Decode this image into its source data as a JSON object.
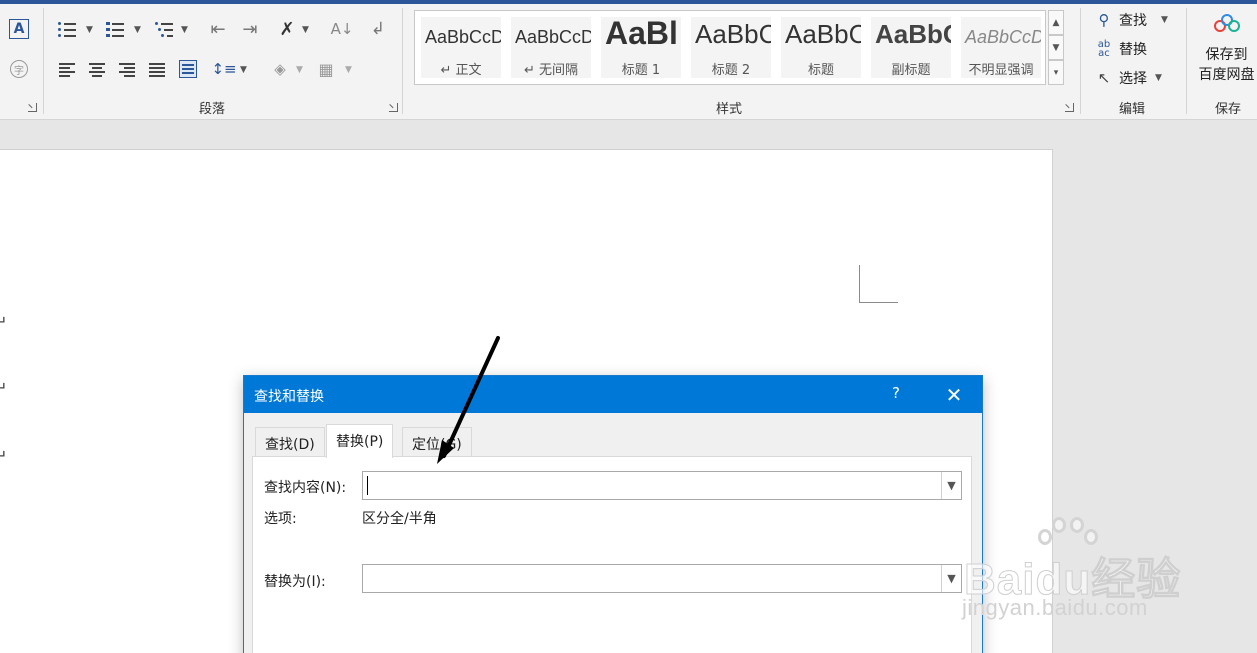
{
  "ribbon": {
    "paragraph_group_label": "段落",
    "styles_group_label": "样式",
    "editing_group_label": "编辑",
    "save_group_label": "保存",
    "styles": [
      {
        "sample": "AaBbCcDd",
        "name": "↵ 正文"
      },
      {
        "sample": "AaBbCcDd",
        "name": "↵ 无间隔"
      },
      {
        "sample": "AaBl",
        "name": "标题 1"
      },
      {
        "sample": "AaBbC",
        "name": "标题 2"
      },
      {
        "sample": "AaBbC",
        "name": "标题"
      },
      {
        "sample": "AaBbC",
        "name": "副标题"
      },
      {
        "sample": "AaBbCcDd",
        "name": "不明显强调"
      }
    ],
    "find_label": "查找",
    "replace_label": "替换",
    "select_label": "选择",
    "save_baidu_line1": "保存到",
    "save_baidu_line2": "百度网盘"
  },
  "document": {
    "paragraph_marks": [
      "↵",
      "↵",
      "↵"
    ]
  },
  "dialog": {
    "title": "查找和替换",
    "help": "?",
    "close": "✕",
    "tabs": [
      {
        "label": "查找(D)"
      },
      {
        "label": "替换(P)"
      },
      {
        "label": "定位(G)"
      }
    ],
    "find_label": "查找内容(N):",
    "find_value": "",
    "options_label": "选项:",
    "options_value": "区分全/半角",
    "replace_label": "替换为(I):",
    "replace_value": ""
  },
  "watermark": {
    "main": "Baidu经验",
    "sub": "jingyan.baidu.com"
  },
  "colors": {
    "accent": "#2b579a",
    "dialog_title": "#0078d7"
  }
}
